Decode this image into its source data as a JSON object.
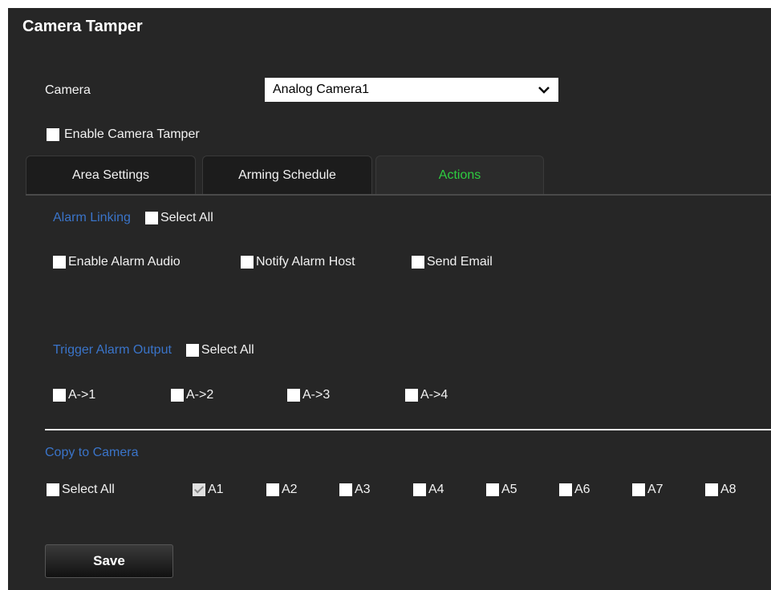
{
  "title": "Camera Tamper",
  "camera": {
    "label": "Camera",
    "selected": "Analog Camera1"
  },
  "enable_tamper": {
    "label": "Enable Camera Tamper",
    "checked": false
  },
  "tabs": [
    {
      "label": "Area Settings",
      "active": false
    },
    {
      "label": "Arming Schedule",
      "active": false
    },
    {
      "label": "Actions",
      "active": true
    }
  ],
  "alarm_linking": {
    "heading": "Alarm Linking",
    "select_all": "Select All",
    "options": [
      "Enable Alarm Audio",
      "Notify Alarm Host",
      "Send Email"
    ]
  },
  "trigger_alarm_output": {
    "heading": "Trigger Alarm Output",
    "select_all": "Select All",
    "outputs": [
      "A->1",
      "A->2",
      "A->3",
      "A->4"
    ]
  },
  "copy_to_camera": {
    "heading": "Copy to Camera",
    "select_all": "Select All",
    "cameras": [
      "A1",
      "A2",
      "A3",
      "A4",
      "A5",
      "A6",
      "A7",
      "A8"
    ],
    "checked": [
      "A1"
    ]
  },
  "save_label": "Save",
  "colors": {
    "background": "#262626",
    "section_heading": "#3a74c9",
    "active_tab": "#2ecc40"
  }
}
